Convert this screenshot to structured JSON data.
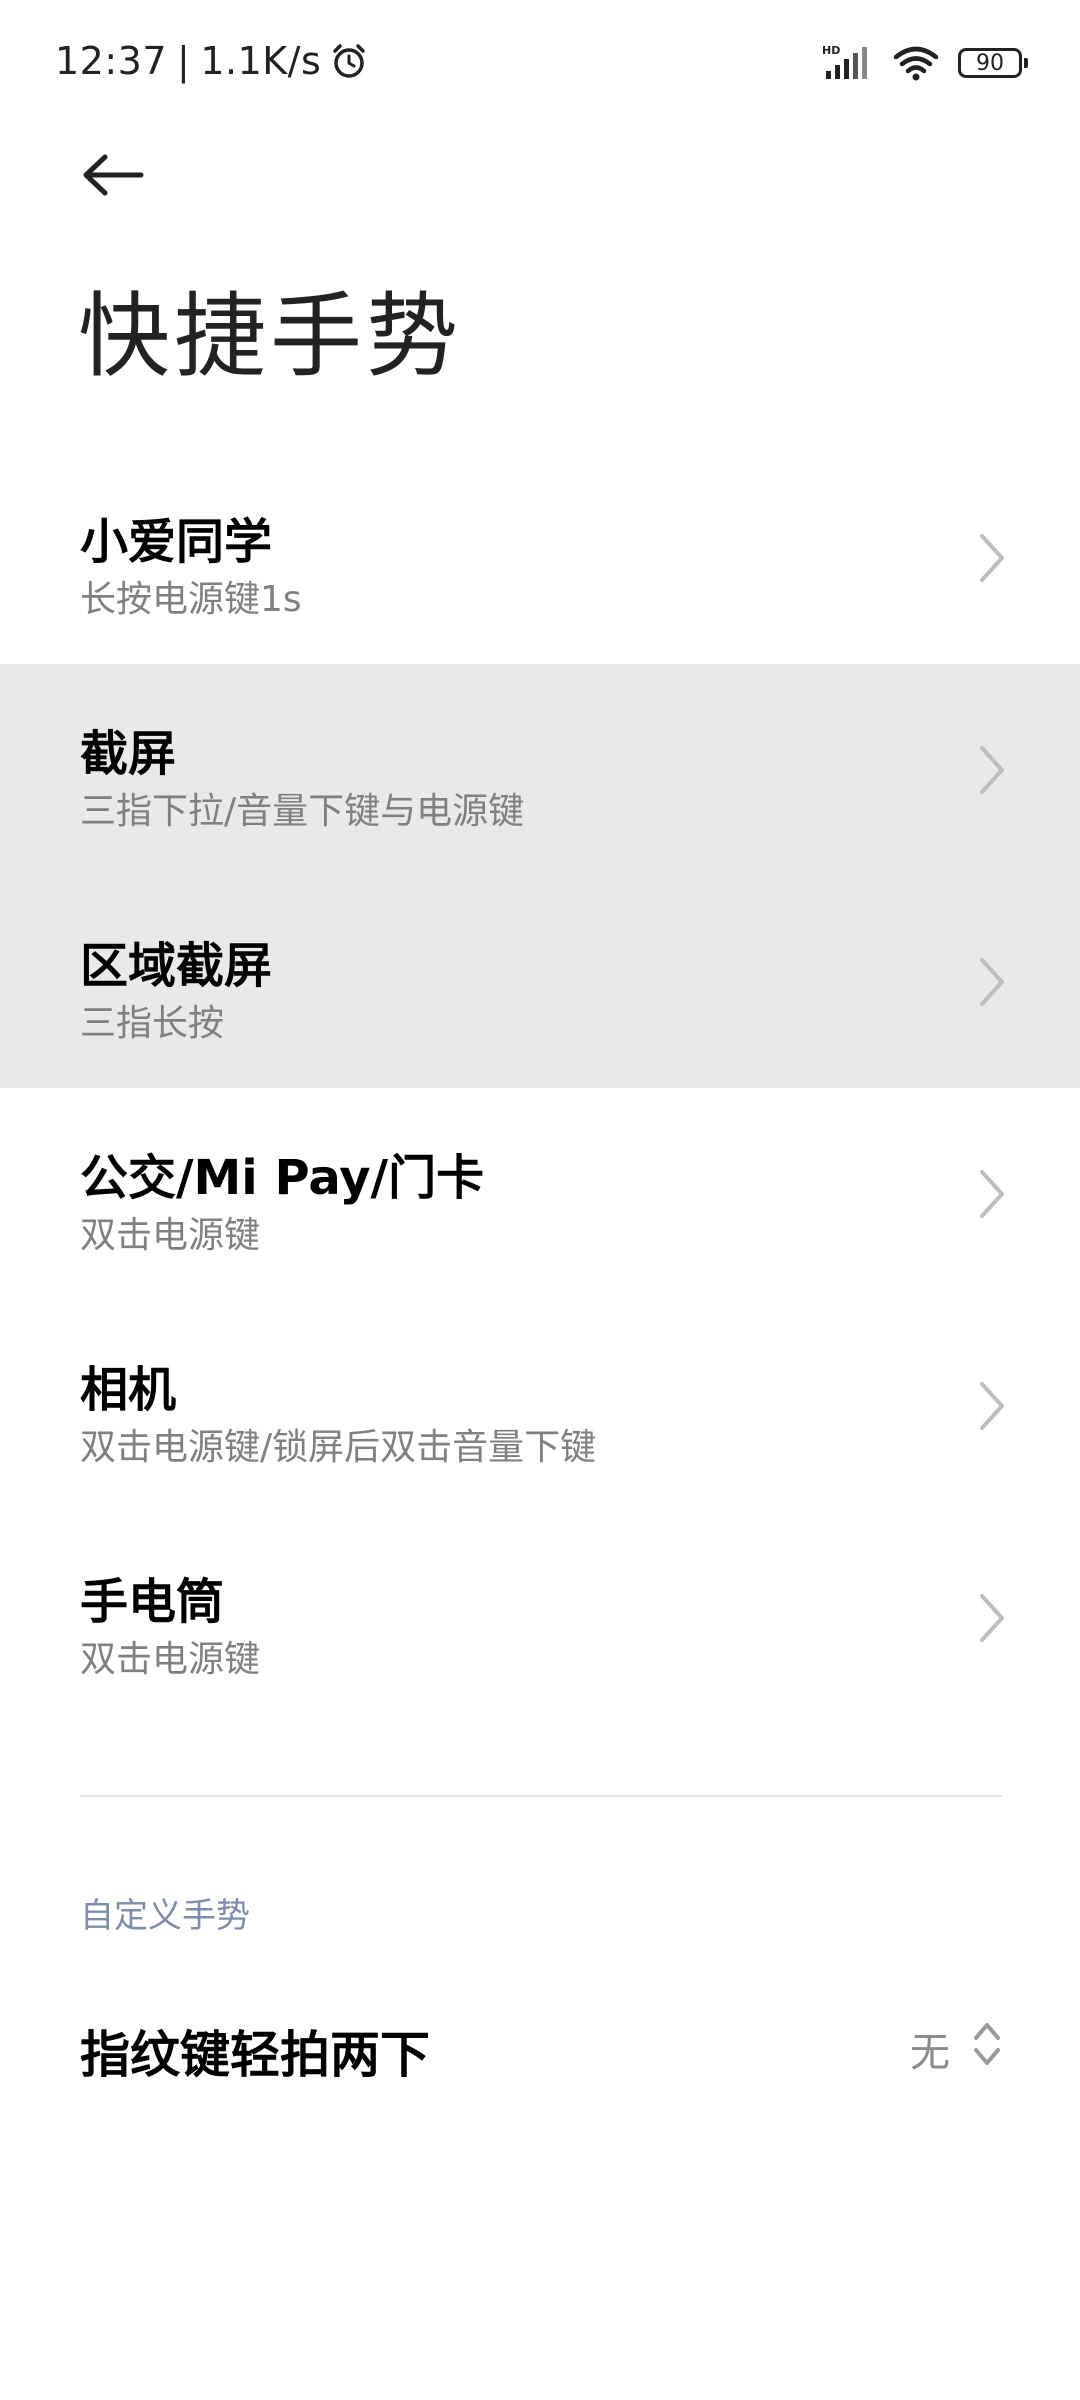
{
  "status_bar": {
    "time": "12:37",
    "network_speed": "1.1K/s",
    "separator": "|",
    "icons": [
      "alarm-icon",
      "hd-signal-icon",
      "wifi-icon",
      "battery-icon"
    ],
    "signal_label": "HD",
    "battery_level": "90"
  },
  "header": {
    "back_icon": "back-arrow-icon",
    "title": "快捷手势"
  },
  "items": [
    {
      "title": "小爱同学",
      "subtitle": "长按电源键1s"
    },
    {
      "title": "截屏",
      "subtitle": "三指下拉/音量下键与电源键"
    },
    {
      "title": "区域截屏",
      "subtitle": "三指长按"
    },
    {
      "title": "公交/Mi Pay/门卡",
      "subtitle": "双击电源键"
    },
    {
      "title": "相机",
      "subtitle": "双击电源键/锁屏后双击音量下键"
    },
    {
      "title": "手电筒",
      "subtitle": "双击电源键"
    }
  ],
  "custom_section": {
    "header": "自定义手势",
    "row": {
      "label": "指纹键轻拍两下",
      "value": "无"
    }
  },
  "colors": {
    "pressed_background": "#e9e9e9",
    "section_header": "#7f8cae",
    "subtitle": "#808080"
  }
}
